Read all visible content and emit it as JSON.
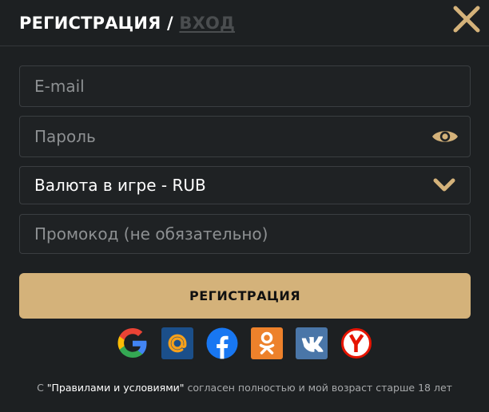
{
  "header": {
    "title": "РЕГИСТРАЦИЯ",
    "separator": " / ",
    "login_link": "ВХОД",
    "close_icon": "close-icon"
  },
  "form": {
    "email_placeholder": "E-mail",
    "password_placeholder": "Пароль",
    "password_icon": "eye-icon",
    "currency_value": "Валюта в игре - RUB",
    "currency_icon": "chevron-down-icon",
    "promo_placeholder": "Промокод (не обязательно)",
    "submit_label": "РЕГИСТРАЦИЯ"
  },
  "social": [
    {
      "name": "google-icon"
    },
    {
      "name": "mail-ru-icon"
    },
    {
      "name": "facebook-icon"
    },
    {
      "name": "odnoklassniki-icon"
    },
    {
      "name": "vk-icon"
    },
    {
      "name": "yandex-icon"
    }
  ],
  "footer": {
    "prefix": "С ",
    "rules_link": "\"Правилами и условиями\"",
    "suffix": " согласен полностью и мой возраст старше 18 лет"
  },
  "colors": {
    "background": "#1d2022",
    "accent": "#d4b27a",
    "field_border": "#3a3e41",
    "placeholder": "#8d9092"
  }
}
